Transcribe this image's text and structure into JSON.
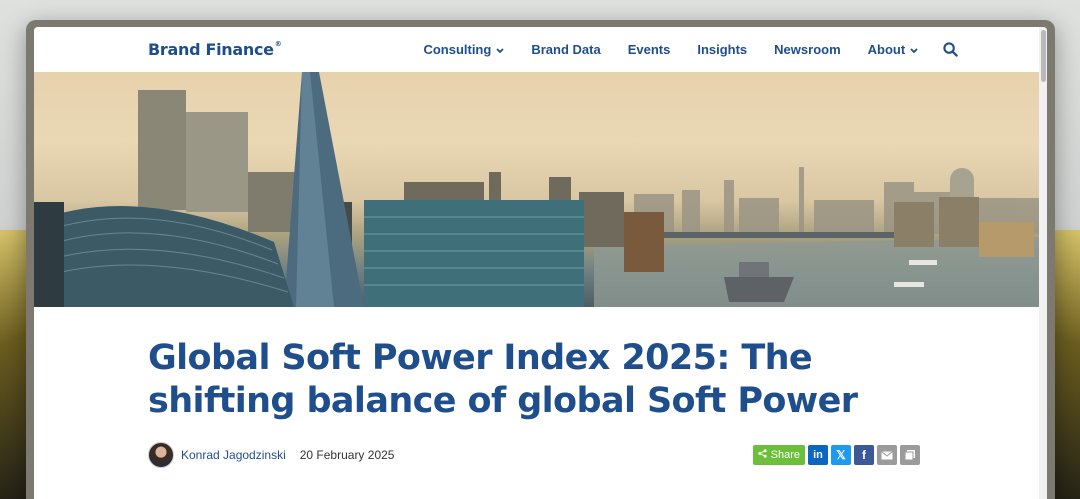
{
  "brand": {
    "name": "Brand Finance",
    "mark": "®"
  },
  "nav": {
    "items": [
      {
        "label": "Consulting",
        "has_dropdown": true
      },
      {
        "label": "Brand Data",
        "has_dropdown": false
      },
      {
        "label": "Events",
        "has_dropdown": false
      },
      {
        "label": "Insights",
        "has_dropdown": false
      },
      {
        "label": "Newsroom",
        "has_dropdown": false
      },
      {
        "label": "About",
        "has_dropdown": true
      }
    ],
    "search_icon": "search-icon"
  },
  "article": {
    "title": "Global Soft Power Index 2025: The shifting balance of global Soft Power",
    "author": "Konrad Jagodzinski",
    "date": "20 February 2025"
  },
  "share": {
    "label": "Share",
    "icons": {
      "linkedin": "in",
      "x": "𝕏",
      "facebook": "f",
      "email": "email-icon",
      "copy": "copy-icon"
    }
  },
  "colors": {
    "brand_blue": "#1f4e8c",
    "share_green": "#6cbf3a",
    "linkedin": "#0a66c2",
    "x": "#1d9bf0",
    "facebook": "#3b5998",
    "neutral_button": "#9b9b9b"
  }
}
